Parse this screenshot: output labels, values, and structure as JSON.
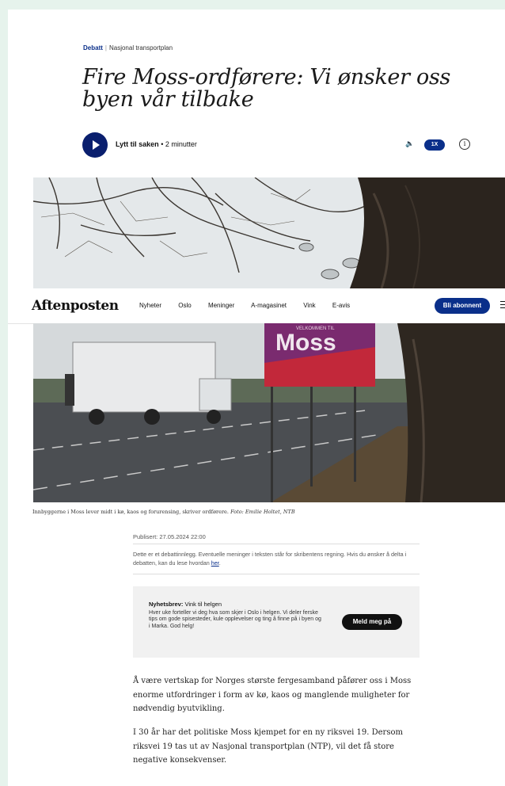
{
  "article": {
    "section": "Debatt",
    "topic": "Nasjonal transportplan",
    "title": "Fire Moss-ordførere: Vi ønsker oss byen vår tilbake"
  },
  "audio": {
    "label": "Lytt til saken",
    "duration": "• 2 minutter",
    "speed": "1X",
    "volume_glyph": "🔈",
    "info_glyph": "i"
  },
  "nav": {
    "logo": "Aftenposten",
    "links": [
      "Nyheter",
      "Oslo",
      "Meninger",
      "A-magasinet",
      "Vink",
      "E-avis"
    ],
    "subscribe": "Bli abonnent"
  },
  "photo": {
    "sign_text": "Moss",
    "sign_sub": "VELKOMMEN TIL",
    "caption": "Innbyggerne i Moss lever midt i kø, kaos og forurensing, skriver ordførere.",
    "credit": "Foto: Emilie Holtet, NTB"
  },
  "meta": {
    "published": "Publisert: 27.05.2024 22:00",
    "disclaimer": "Dette er et debattinnlegg. Eventuelle meninger i teksten står for skribentens regning. Hvis du ønsker å delta i debatten, kan du lese hvordan",
    "disclaimer_link": "her",
    "disclaimer_end": "."
  },
  "newsletter": {
    "label": "Nyhetsbrev:",
    "name": "Vink til helgen",
    "text": "Hver uke forteller vi deg hva som skjer i Oslo i helgen. Vi deler ferske tips om gode spisesteder, kule opplevelser og ting å finne på i byen og i Marka. God helg!",
    "button": "Meld meg på"
  },
  "body": {
    "p1": "Å være vertskap for Norges største fergesamband påfører oss i Moss enorme utfordringer i form av kø, kaos og manglende muligheter for nødvendig byutvikling.",
    "p2": "I 30 år har det politiske Moss kjempet for en ny riksvei 19. Dersom riksvei 19 tas ut av Nasjonal transportplan (NTP), vil det få store negative konsekvenser."
  },
  "colors": {
    "brand_blue": "#0a2f8a",
    "play_navy": "#0a1f6e",
    "page_bg": "#e6f3ec",
    "sign_magenta": "#7a2b6f",
    "sign_red": "#c2283a"
  }
}
